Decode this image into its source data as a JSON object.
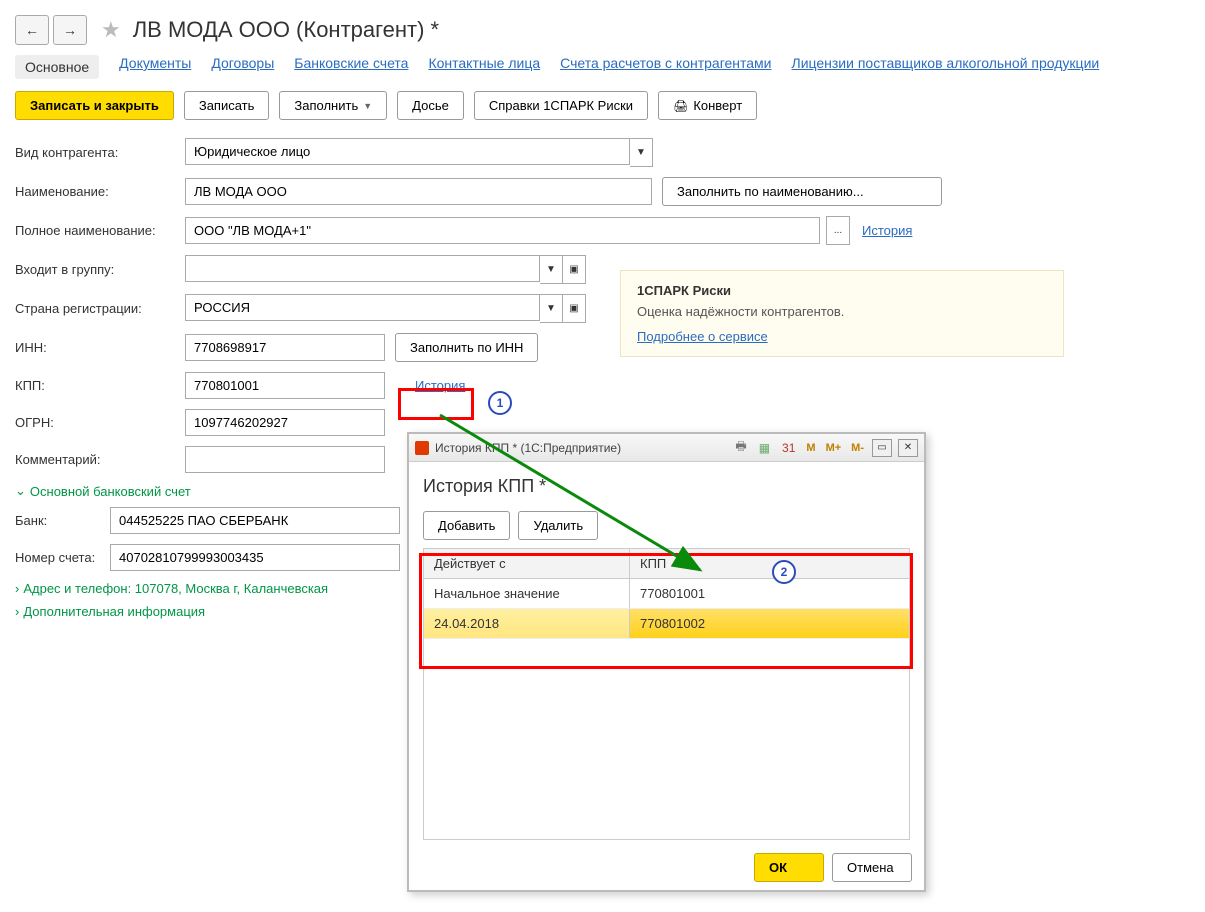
{
  "header": {
    "title": "ЛВ МОДА ООО (Контрагент) *"
  },
  "tabs": {
    "main": "Основное",
    "documents": "Документы",
    "contracts": "Договоры",
    "bank_accounts": "Банковские счета",
    "contacts": "Контактные лица",
    "settlement_accounts": "Счета расчетов с контрагентами",
    "licenses": "Лицензии поставщиков алкогольной продукции"
  },
  "toolbar": {
    "save_close": "Записать и закрыть",
    "save": "Записать",
    "fill": "Заполнить",
    "dossier": "Досье",
    "spark": "Справки 1СПАРК Риски",
    "envelope": "Конверт"
  },
  "form": {
    "type_label": "Вид контрагента:",
    "type_value": "Юридическое лицо",
    "name_label": "Наименование:",
    "name_value": "ЛВ МОДА ООО",
    "fill_by_name": "Заполнить по наименованию...",
    "full_name_label": "Полное наименование:",
    "full_name_value": "ООО \"ЛВ МОДА+1\"",
    "history_link": "История",
    "group_label": "Входит в группу:",
    "group_value": "",
    "country_label": "Страна регистрации:",
    "country_value": "РОССИЯ",
    "inn_label": "ИНН:",
    "inn_value": "7708698917",
    "fill_by_inn": "Заполнить по ИНН",
    "kpp_label": "КПП:",
    "kpp_value": "770801001",
    "kpp_history": "История",
    "ogrn_label": "ОГРН:",
    "ogrn_value": "1097746202927",
    "comment_label": "Комментарий:",
    "comment_value": ""
  },
  "sections": {
    "bank_section": "Основной банковский счет",
    "bank_label": "Банк:",
    "bank_value": "044525225 ПАО СБЕРБАНК",
    "account_label": "Номер счета:",
    "account_value": "40702810799993003435",
    "address_section": "Адрес и телефон: 107078, Москва г, Каланчевская",
    "extra_section": "Дополнительная информация"
  },
  "spark": {
    "title": "1СПАРК Риски",
    "desc": "Оценка надёжности контрагентов.",
    "more": "Подробнее о сервисе"
  },
  "dialog": {
    "titlebar": "История КПП * (1С:Предприятие)",
    "m": "M",
    "m_plus": "M+",
    "m_minus": "M-",
    "heading": "История КПП *",
    "add_btn": "Добавить",
    "del_btn": "Удалить",
    "col_date": "Действует с",
    "col_kpp": "КПП",
    "rows": [
      {
        "date": "Начальное значение",
        "kpp": "770801001"
      },
      {
        "date": "24.04.2018",
        "kpp": "770801002"
      }
    ],
    "ok": "ОК",
    "cancel": "Отмена"
  },
  "badges": {
    "one": "1",
    "two": "2"
  },
  "ellipsis": "..."
}
